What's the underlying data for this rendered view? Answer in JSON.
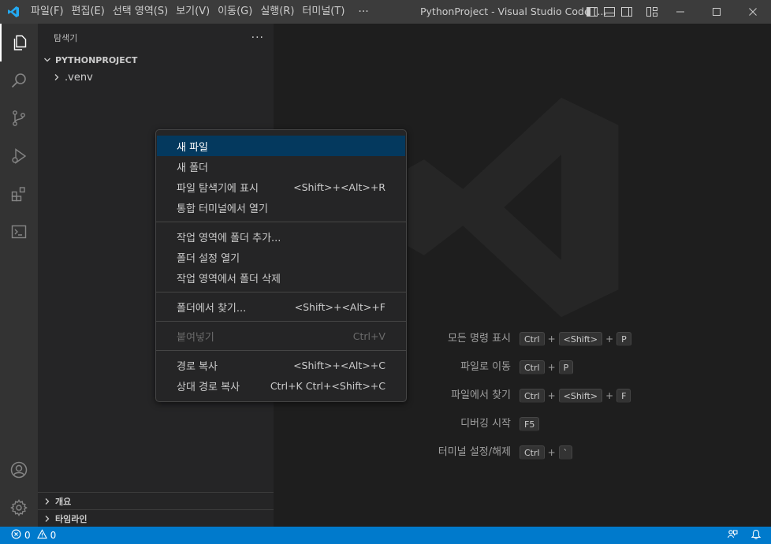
{
  "app": {
    "window_title": "PythonProject - Visual Studio Code [...",
    "accent_color": "#007acc"
  },
  "menu": {
    "items": [
      "파일(F)",
      "편집(E)",
      "선택 영역(S)",
      "보기(V)",
      "이동(G)",
      "실행(R)",
      "터미널(T)"
    ],
    "more": "···"
  },
  "activity_bar": {
    "icons": [
      "explorer-icon",
      "search-icon",
      "source-control-icon",
      "run-debug-icon",
      "extensions-icon",
      "terminal-icon",
      "account-icon",
      "settings-gear-icon"
    ]
  },
  "sidebar": {
    "title": "탐색기",
    "more": "···",
    "project": "PYTHONPROJECT",
    "tree": [
      ".venv"
    ],
    "outline": "개요",
    "timeline": "타임라인"
  },
  "context_menu": {
    "groups": [
      [
        {
          "label": "새 파일",
          "shortcut": ""
        },
        {
          "label": "새 폴더",
          "shortcut": ""
        },
        {
          "label": "파일 탐색기에 표시",
          "shortcut": "<Shift>+<Alt>+R"
        },
        {
          "label": "통합 터미널에서 열기",
          "shortcut": ""
        }
      ],
      [
        {
          "label": "작업 영역에 폴더 추가...",
          "shortcut": ""
        },
        {
          "label": "폴더 설정 열기",
          "shortcut": ""
        },
        {
          "label": "작업 영역에서 폴더 삭제",
          "shortcut": ""
        }
      ],
      [
        {
          "label": "폴더에서 찾기...",
          "shortcut": "<Shift>+<Alt>+F"
        }
      ],
      [
        {
          "label": "붙여넣기",
          "shortcut": "Ctrl+V"
        }
      ],
      [
        {
          "label": "경로 복사",
          "shortcut": "<Shift>+<Alt>+C"
        },
        {
          "label": "상대 경로 복사",
          "shortcut": "Ctrl+K Ctrl+<Shift>+C"
        }
      ]
    ],
    "selected": "새 파일",
    "disabled": "붙여넣기"
  },
  "editor": {
    "shortcuts": [
      {
        "label": "모든 명령 표시",
        "keys": [
          "Ctrl",
          "<Shift>",
          "P"
        ]
      },
      {
        "label": "파일로 이동",
        "keys": [
          "Ctrl",
          "P"
        ]
      },
      {
        "label": "파일에서 찾기",
        "keys": [
          "Ctrl",
          "<Shift>",
          "F"
        ]
      },
      {
        "label": "디버깅 시작",
        "keys": [
          "F5"
        ]
      },
      {
        "label": "터미널 설정/해제",
        "keys": [
          "Ctrl",
          "`"
        ]
      }
    ],
    "plus": "+"
  },
  "status_bar": {
    "errors": "0",
    "warnings": "0"
  }
}
